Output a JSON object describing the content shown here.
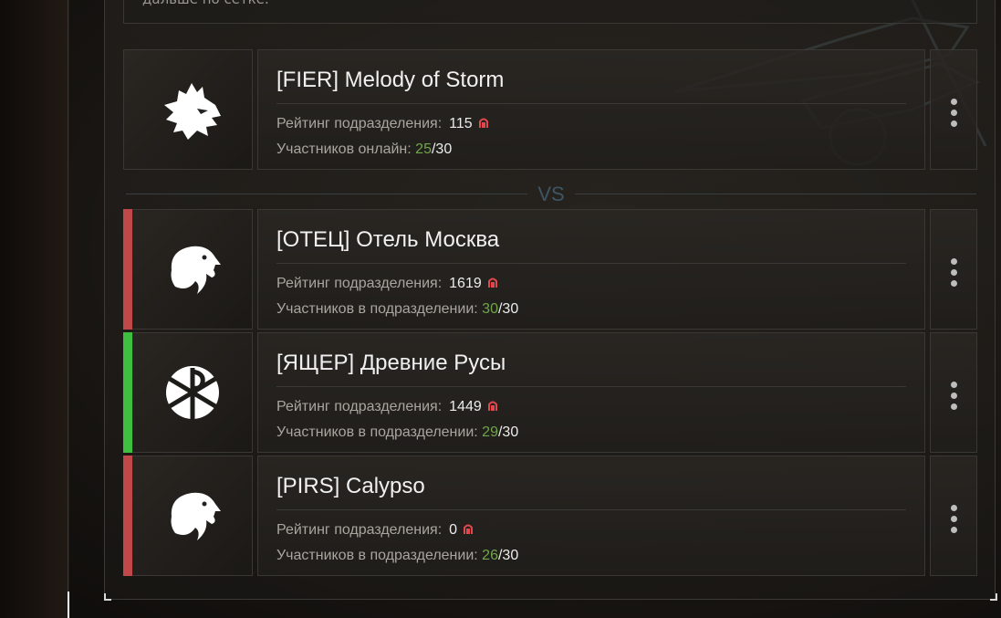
{
  "info_text": "дальше по сетке.",
  "vs_label": "VS",
  "rating_label": "Рейтинг подразделения:",
  "colors": {
    "win": "#3fbf3f",
    "loss": "#c04848",
    "online": "#6fa64a",
    "rank_icon": "#e0484e"
  },
  "own_unit": {
    "title": "[FIER] Melody of Storm",
    "rating": "115",
    "members_label": "Участников онлайн:",
    "members_online": "25",
    "members_total": "30",
    "logo_icon": "wolf-icon"
  },
  "opponents": [
    {
      "title": "[ОТЕЦ] Отель Москва",
      "rating": "1619",
      "members_label": "Участников в подразделении:",
      "members_count": "30",
      "members_total": "30",
      "status": "loss",
      "logo_icon": "eagle-icon"
    },
    {
      "title": "[ЯЩЕР] Древние Русы",
      "rating": "1449",
      "members_label": "Участников в подразделении:",
      "members_count": "29",
      "members_total": "30",
      "status": "win",
      "logo_icon": "chi-rho-icon"
    },
    {
      "title": "[PIRS] Calypso",
      "rating": "0",
      "members_label": "Участников в подразделении:",
      "members_count": "26",
      "members_total": "30",
      "status": "loss",
      "logo_icon": "eagle-icon"
    }
  ]
}
